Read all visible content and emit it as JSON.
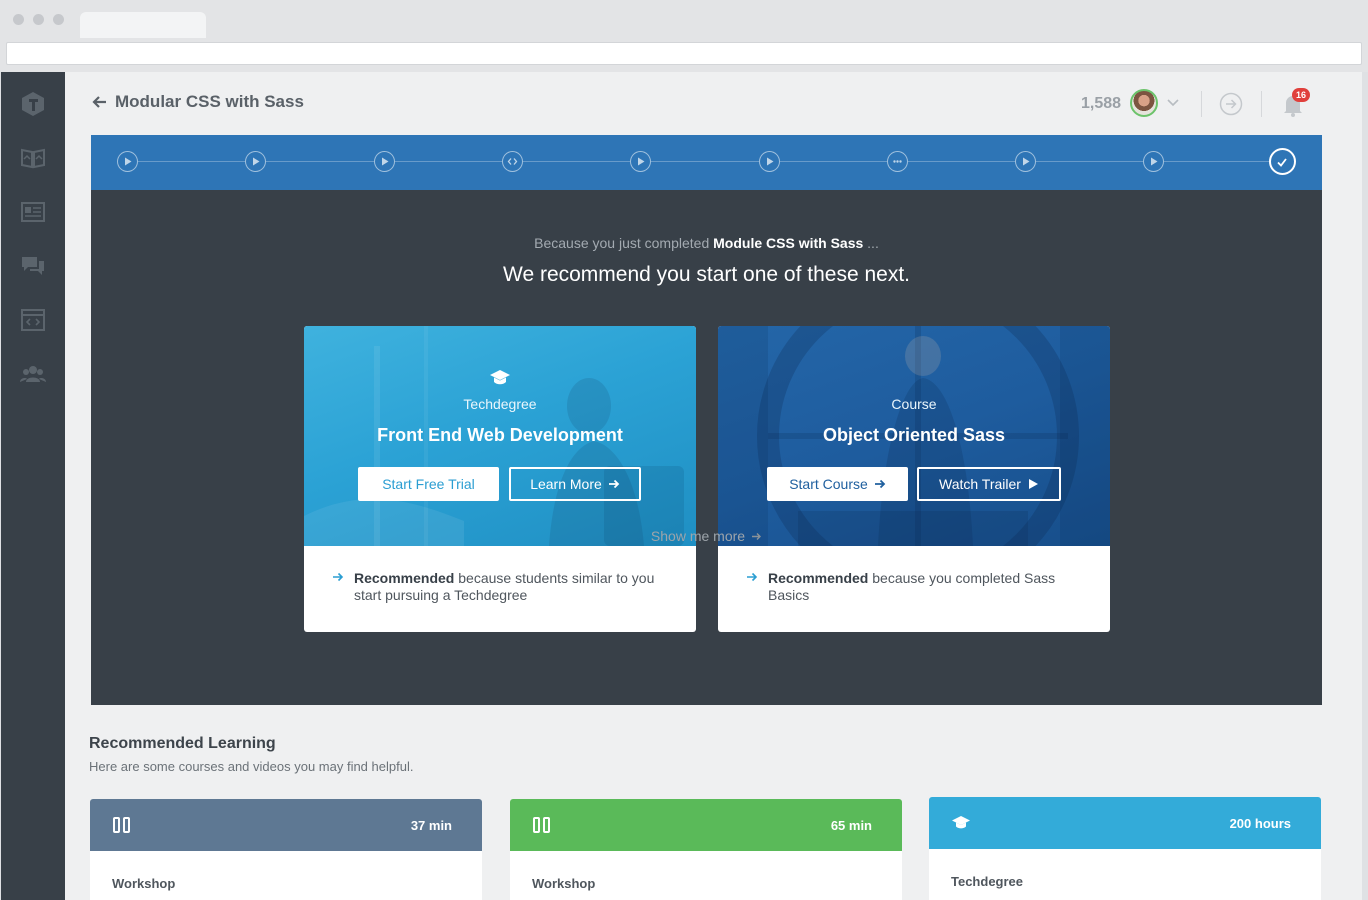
{
  "breadcrumb": {
    "back_label": "Modular CSS with Sass"
  },
  "header": {
    "points": "1,588",
    "notifications_count": "16"
  },
  "progress": {
    "steps": [
      "video",
      "video",
      "video",
      "code",
      "video",
      "video",
      "quiz",
      "video",
      "video",
      "complete"
    ],
    "complete_index": 9
  },
  "recommend": {
    "because_prefix": "Because you just completed",
    "because_course": "Module CSS with Sass",
    "because_suffix": "...",
    "headline": "We recommend you start one of these next.",
    "show_more": "Show me more",
    "cards": [
      {
        "kicker": "Techdegree",
        "title": "Front End Web Development",
        "primary": "Start Free Trial",
        "secondary": "Learn More",
        "reason_bold": "Recommended",
        "reason_rest": "because students similar to you start pursuing a Techdegree"
      },
      {
        "kicker": "Course",
        "title": "Object Oriented Sass",
        "primary": "Start Course",
        "secondary": "Watch Trailer",
        "reason_bold": "Recommended",
        "reason_rest": "because you completed Sass Basics"
      }
    ]
  },
  "learning": {
    "title": "Recommended Learning",
    "subtitle": "Here are some courses and videos you may find helpful.",
    "cards": [
      {
        "duration": "37 min",
        "type": "Workshop",
        "color": "#5e7893",
        "icon": "workshop-icon"
      },
      {
        "duration": "65 min",
        "type": "Workshop",
        "color": "#5aba59",
        "icon": "workshop-icon"
      },
      {
        "duration": "200 hours",
        "type": "Techdegree",
        "color": "#33abd9",
        "icon": "graduation-cap-icon"
      }
    ]
  },
  "colors": {
    "accent_blue": "#2e75b6",
    "panel_dark": "#384048",
    "sidebar": "#384048"
  }
}
